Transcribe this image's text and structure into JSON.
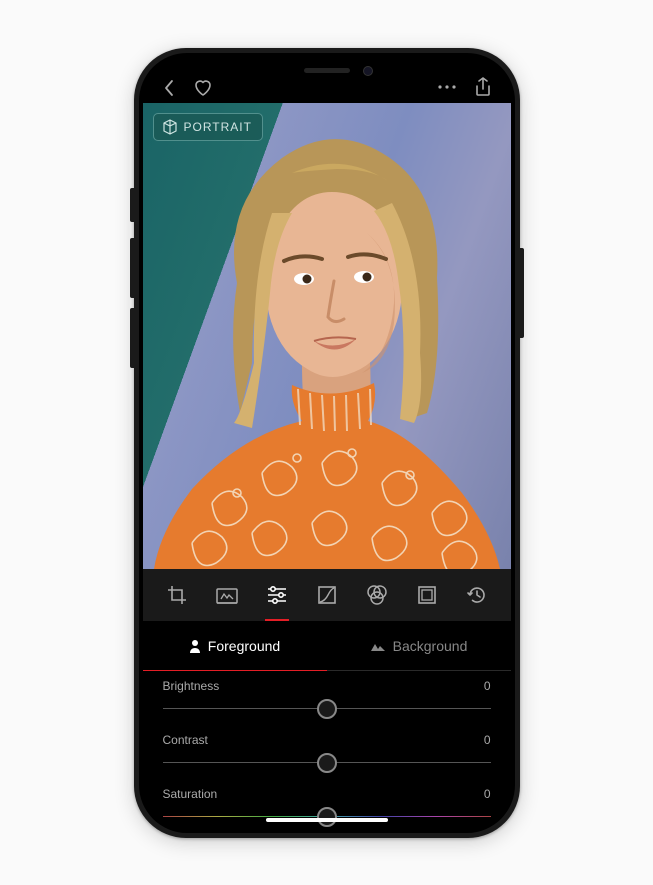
{
  "topBar": {
    "back": "back-chevron-icon",
    "favorite": "heart-icon",
    "more": "more-icon",
    "share": "share-icon"
  },
  "badge": {
    "label": "PORTRAIT",
    "icon": "cube-icon"
  },
  "tools": [
    {
      "name": "crop-icon",
      "active": false
    },
    {
      "name": "auto-icon",
      "active": false
    },
    {
      "name": "adjust-sliders-icon",
      "active": true
    },
    {
      "name": "curves-icon",
      "active": false
    },
    {
      "name": "filters-icon",
      "active": false
    },
    {
      "name": "frames-icon",
      "active": false
    },
    {
      "name": "history-icon",
      "active": false
    }
  ],
  "tabs": {
    "foreground": {
      "label": "Foreground",
      "icon": "person-icon",
      "active": true
    },
    "background": {
      "label": "Background",
      "icon": "mountains-icon",
      "active": false
    }
  },
  "sliders": [
    {
      "label": "Brightness",
      "value": 0,
      "position": 50,
      "type": "plain"
    },
    {
      "label": "Contrast",
      "value": 0,
      "position": 50,
      "type": "plain"
    },
    {
      "label": "Saturation",
      "value": 0,
      "position": 50,
      "type": "rainbow"
    }
  ],
  "colors": {
    "accent": "#e41e26",
    "screenBg": "#000000",
    "panelBg": "#1a1a1a"
  }
}
